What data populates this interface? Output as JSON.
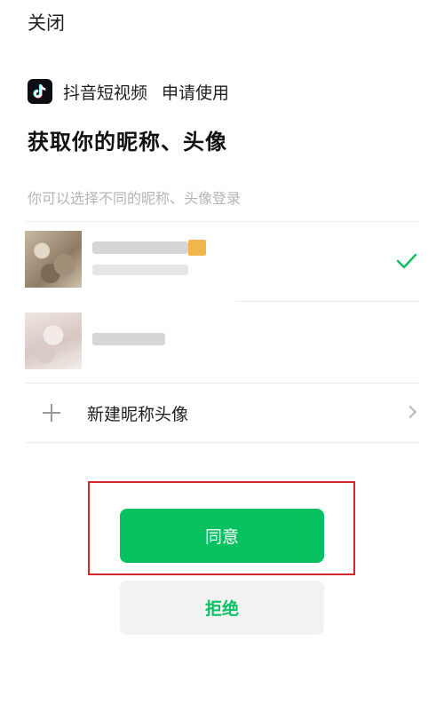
{
  "header": {
    "close_label": "关闭"
  },
  "app": {
    "name": "抖音短视频",
    "request": "申请使用",
    "logo_icon": "tiktok-logo-icon"
  },
  "page": {
    "title": "获取你的昵称、头像",
    "subtitle": "你可以选择不同的昵称、头像登录"
  },
  "accounts": [
    {
      "name_blurred": true,
      "selected": true
    },
    {
      "name_blurred": true,
      "selected": false
    }
  ],
  "new_profile": {
    "label": "新建昵称头像"
  },
  "buttons": {
    "agree": "同意",
    "reject": "拒绝"
  },
  "colors": {
    "accent": "#07c160",
    "highlight": "#d32b2b",
    "reject_bg": "#f2f2f2"
  }
}
